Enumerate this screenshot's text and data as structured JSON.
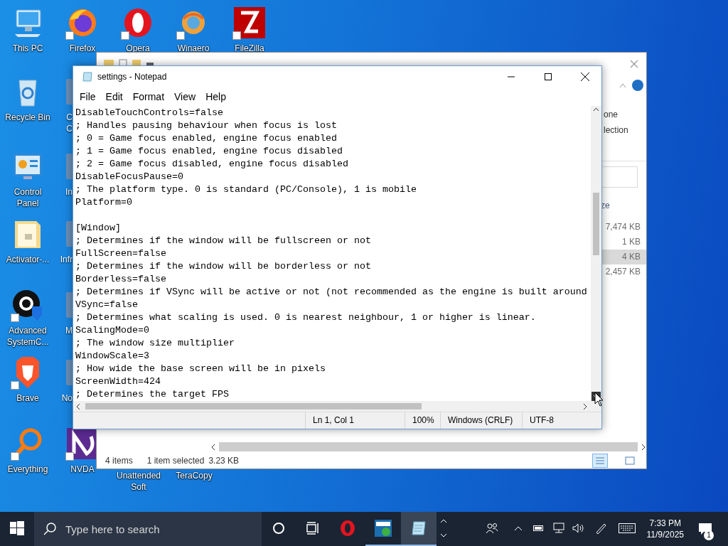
{
  "desktop_icons": [
    {
      "label": "This PC",
      "kind": "pc",
      "shortcut": false
    },
    {
      "label": "Firefox",
      "kind": "firefox",
      "shortcut": true
    },
    {
      "label": "Opera",
      "kind": "opera",
      "shortcut": true
    },
    {
      "label": "Winaero",
      "kind": "winaero",
      "shortcut": true
    },
    {
      "label": "FileZilla",
      "kind": "filezilla",
      "shortcut": true
    },
    {
      "label": "Recycle Bin",
      "kind": "recycle",
      "shortcut": false
    },
    {
      "label": "Control Panel",
      "kind": "control",
      "shortcut": false
    },
    {
      "label": "Activator-...",
      "kind": "folder",
      "shortcut": false
    },
    {
      "label": "Advanced SystemC...",
      "kind": "asc",
      "shortcut": true
    },
    {
      "label": "Brave",
      "kind": "brave",
      "shortcut": true
    },
    {
      "label": "Everything",
      "kind": "everything",
      "shortcut": true
    },
    {
      "label": "NVDA",
      "kind": "nvda",
      "shortcut": true
    }
  ],
  "covered_icons": [
    {
      "lines": [
        "C",
        "C"
      ]
    },
    {
      "lines": [
        "In"
      ]
    },
    {
      "lines": [
        "Infr"
      ]
    },
    {
      "lines": [
        "M"
      ]
    },
    {
      "lines": [
        "No"
      ]
    }
  ],
  "bottom_labels": [
    {
      "lines": [
        "Unattended",
        "Soft"
      ]
    },
    {
      "lines": [
        "TeraCopy"
      ]
    }
  ],
  "explorer": {
    "ribbon_texts": [
      "one",
      "lection"
    ],
    "column_header": "ze",
    "sizes": [
      {
        "text": "7,474 KB",
        "selected": false
      },
      {
        "text": "1 KB",
        "selected": false
      },
      {
        "text": "4 KB",
        "selected": true
      },
      {
        "text": "2,457 KB",
        "selected": false
      }
    ],
    "status": {
      "count": "4 items",
      "selection": "1 item selected",
      "size": "3.23 KB"
    }
  },
  "notepad": {
    "title": "settings - Notepad",
    "menu": [
      "File",
      "Edit",
      "Format",
      "View",
      "Help"
    ],
    "blocks": [
      [
        "DisableTouchControls=false",
        "; Handles pausing behaviour when focus is lost",
        "; 0 = Game focus enabled, engine focus enabled",
        "; 1 = Game focus enabled, engine focus disabled",
        "; 2 = Game focus disabled, engine focus disabled",
        "DisableFocusPause=0",
        "; The platform type. 0 is standard (PC/Console), 1 is mobile",
        "Platform=0"
      ],
      [
        "[Window]",
        "; Determines if the window will be fullscreen or not",
        "FullScreen=false",
        "; Determines if the window will be borderless or not",
        "Borderless=false",
        "; Determines if VSync will be active or not (not recommended as the engine is built around",
        "VSync=false",
        "; Determines what scaling is used. 0 is nearest neighbour, 1 or higher is linear.",
        "ScalingMode=0",
        "; The window size multiplier",
        "WindowScale=3",
        "; How wide the base screen will be in pixels",
        "ScreenWidth=424",
        "; Determines the target FPS"
      ]
    ],
    "status": [
      "Ln 1, Col 1",
      "100%",
      "Windows (CRLF)",
      "UTF-8"
    ]
  },
  "taskbar": {
    "search_placeholder": "Type here to search",
    "apps": [
      {
        "kind": "opera",
        "running": false,
        "selected": false
      },
      {
        "kind": "greenapp",
        "running": true,
        "selected": false
      },
      {
        "kind": "notepad",
        "running": true,
        "selected": true
      }
    ],
    "time": "7:33 PM",
    "date": "11/9/2025",
    "notifications": "1"
  }
}
